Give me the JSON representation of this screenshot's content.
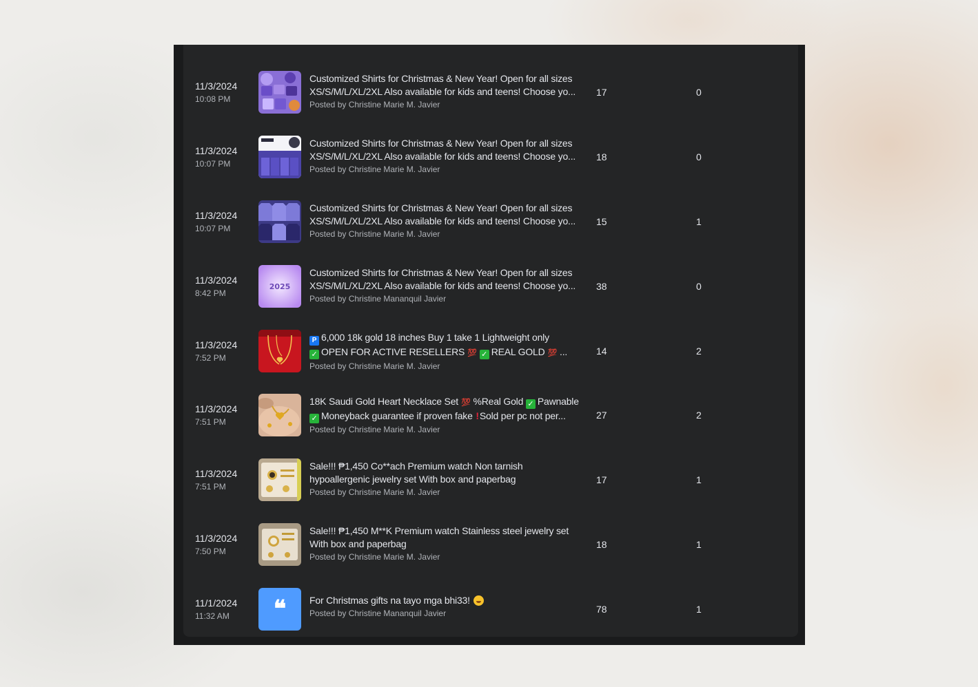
{
  "posts": [
    {
      "date": "11/3/2024",
      "time": "10:08 PM",
      "line1": "Customized Shirts for Christmas & New Year! Open for all sizes",
      "line2": "XS/S/M/L/XL/2XL Also available for kids and teens! Choose yo...",
      "poster": "Posted by Christine Marie M. Javier",
      "reach": "17",
      "engagement": "0",
      "thumbnail": "purple-shirts-collage"
    },
    {
      "date": "11/3/2024",
      "time": "10:07 PM",
      "line1": "Customized Shirts for Christmas & New Year! Open for all sizes",
      "line2": "XS/S/M/L/XL/2XL Also available for kids and teens! Choose yo...",
      "poster": "Posted by Christine Marie M. Javier",
      "reach": "18",
      "engagement": "0",
      "thumbnail": "shirt-template-sheet"
    },
    {
      "date": "11/3/2024",
      "time": "10:07 PM",
      "line1": "Customized Shirts for Christmas & New Year! Open for all sizes",
      "line2": "XS/S/M/L/XL/2XL Also available for kids and teens! Choose yo...",
      "poster": "Posted by Christine Marie M. Javier",
      "reach": "15",
      "engagement": "1",
      "thumbnail": "blue-shirts-grid"
    },
    {
      "date": "11/3/2024",
      "time": "8:42 PM",
      "line1": "Customized Shirts for Christmas & New Year! Open for all sizes",
      "line2": "XS/S/M/L/XL/2XL Also available for kids and teens! Choose yo...",
      "poster": "Posted by Christine Mananquil Javier",
      "reach": "38",
      "engagement": "0",
      "thumbnail": "lavender-2025-card",
      "thumb_text": "2025"
    },
    {
      "date": "11/3/2024",
      "time": "7:52 PM",
      "line1_text": "6,000 18k gold 18 inches Buy 1 take 1 Lightweight only",
      "line2_a": "OPEN FOR ACTIVE RESELLERS",
      "line2_b": "REAL GOLD",
      "line2_c": "...",
      "poster": "Posted by Christine Marie M. Javier",
      "reach": "14",
      "engagement": "2",
      "thumbnail": "gold-necklace-red"
    },
    {
      "date": "11/3/2024",
      "time": "7:51 PM",
      "line1_a": "18K Saudi Gold Heart Necklace Set",
      "line1_b": "%Real Gold",
      "line1_c": "Pawnable",
      "line2_a": "Moneyback guarantee if proven fake",
      "line2_b": "Sold per pc not per...",
      "poster": "Posted by Christine Marie M. Javier",
      "reach": "27",
      "engagement": "2",
      "thumbnail": "gold-heart-hand"
    },
    {
      "date": "11/3/2024",
      "time": "7:51 PM",
      "line1": "Sale!!! ₱1,450 Co**ach Premium watch Non tarnish",
      "line2": "hypoallergenic jewelry set With box and paperbag",
      "poster": "Posted by Christine Marie M. Javier",
      "reach": "17",
      "engagement": "1",
      "thumbnail": "watch-set-box"
    },
    {
      "date": "11/3/2024",
      "time": "7:50 PM",
      "line1": "Sale!!! ₱1,450 M**K Premium watch Stainless steel jewelry set",
      "line2": "With box and paperbag",
      "poster": "Posted by Christine Marie M. Javier",
      "reach": "18",
      "engagement": "1",
      "thumbnail": "watch-set-box-2"
    },
    {
      "date": "11/1/2024",
      "time": "11:32 AM",
      "line1": "For Christmas gifts na tayo mga bhi33!",
      "poster": "Posted by Christine Mananquil Javier",
      "reach": "78",
      "engagement": "1",
      "thumbnail": "quote-icon",
      "thumb_glyph": "❝"
    }
  ],
  "colors": {
    "panel": "#242526",
    "frame": "#1a1b1c",
    "primary_text": "#e4e6eb",
    "secondary_text": "#b0b3b8",
    "quote_blue": "#4f9bff"
  },
  "emoji": {
    "p_badge": "P",
    "check": "✓",
    "hundred": "💯",
    "bang": "!"
  }
}
